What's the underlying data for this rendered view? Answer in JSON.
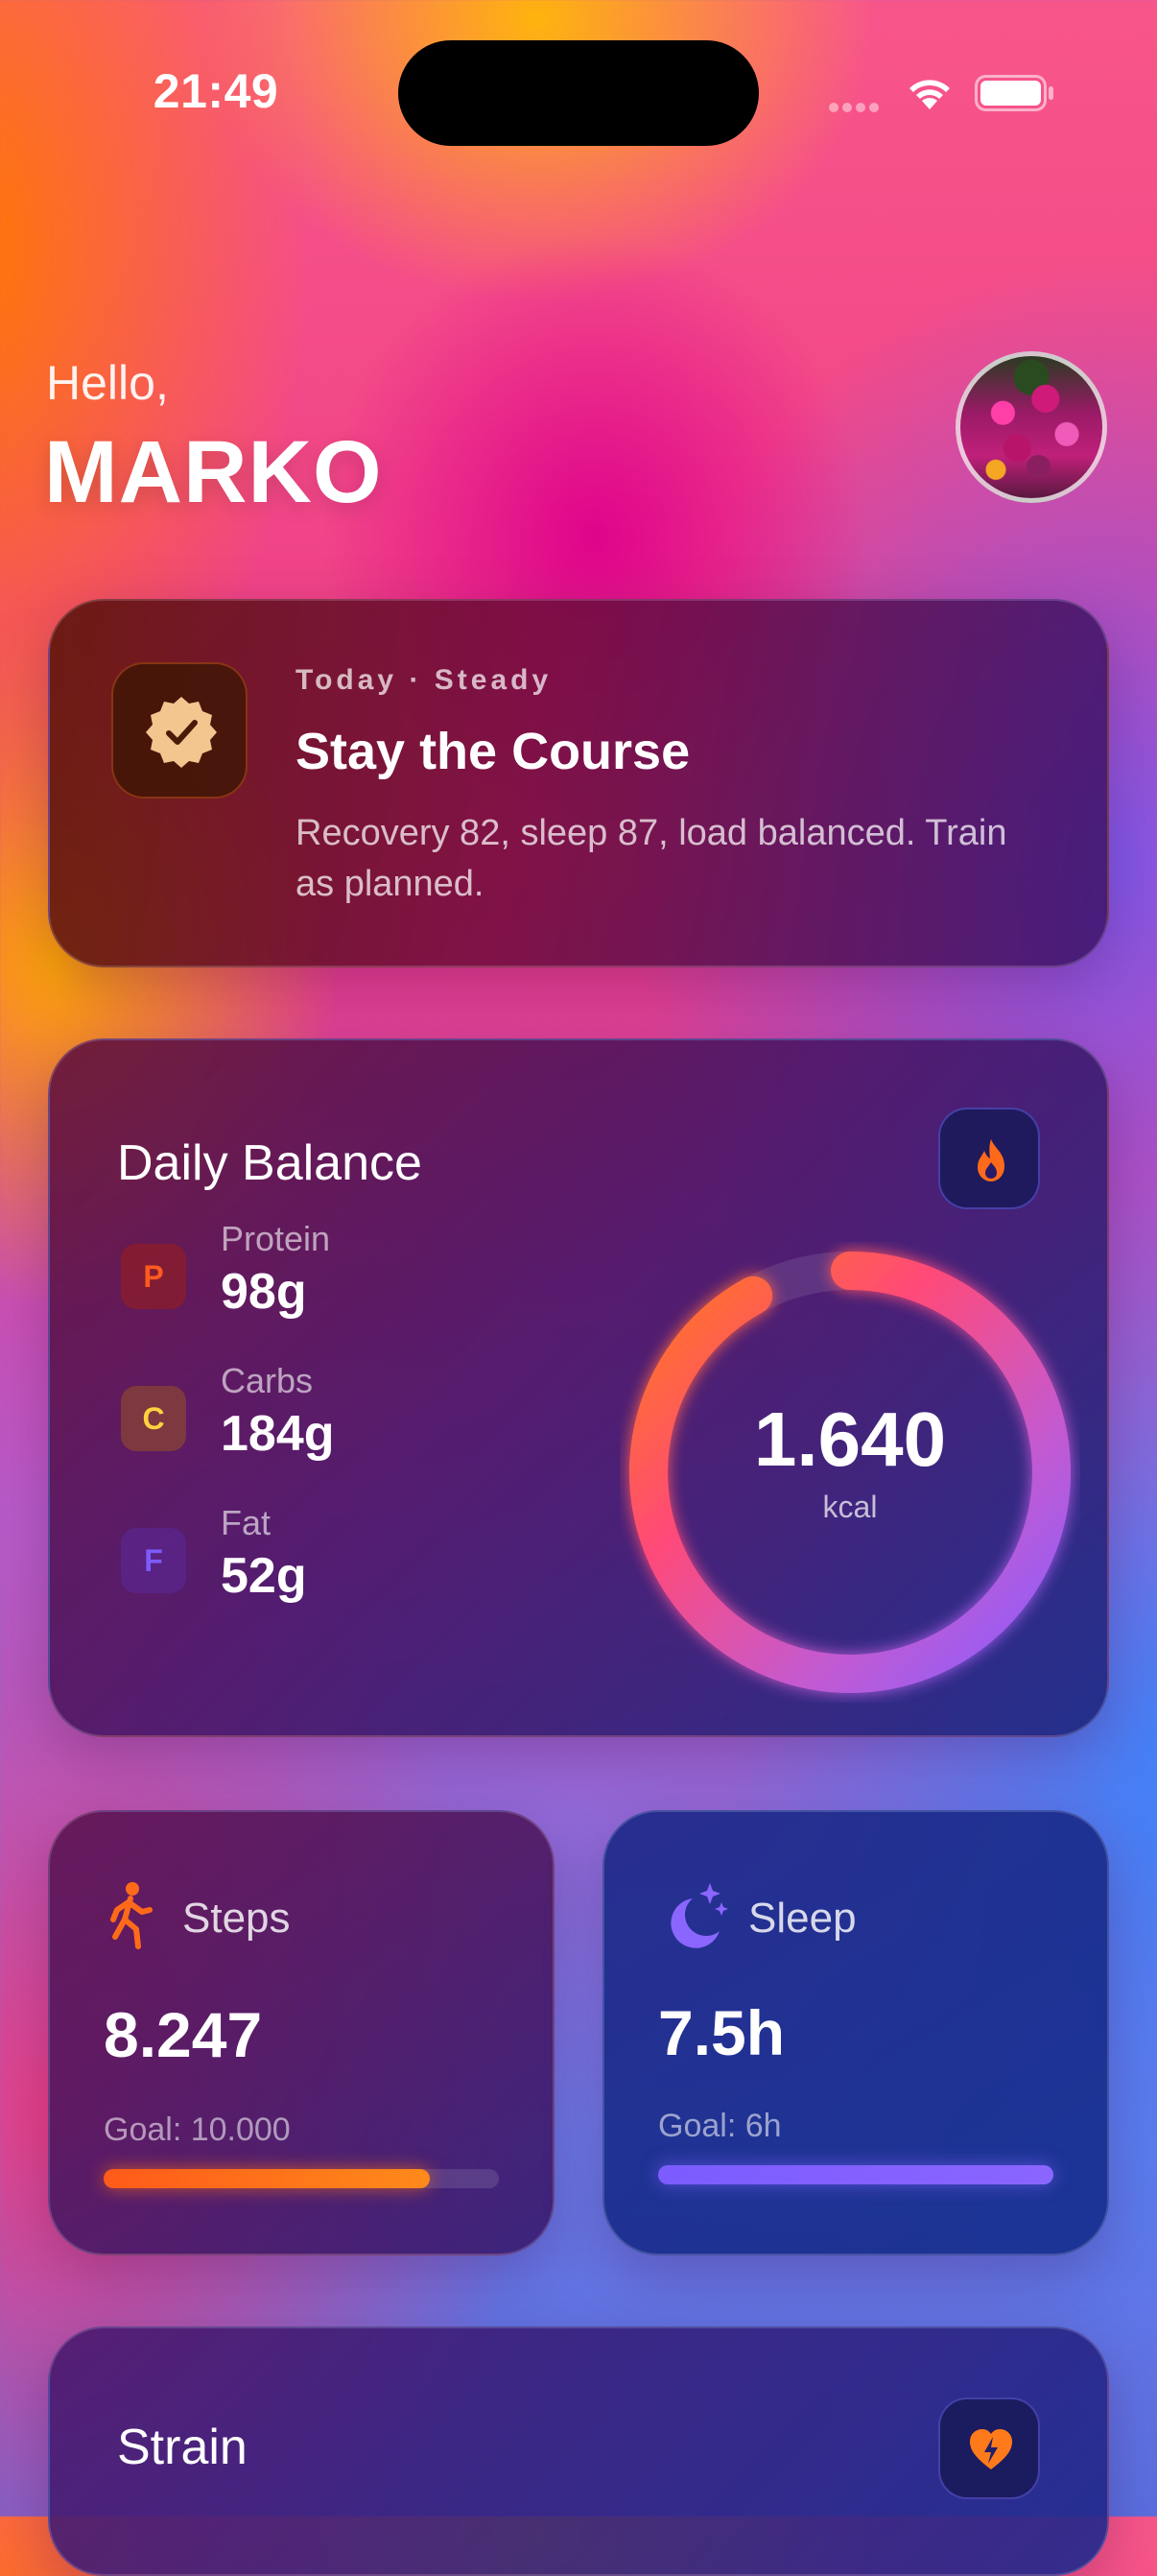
{
  "status_bar": {
    "time": "21:49"
  },
  "header": {
    "greeting": "Hello,",
    "name": "MARKO"
  },
  "insight": {
    "eyebrow": "Today · Steady",
    "title": "Stay the Course",
    "body": "Recovery 82, sleep 87, load balanced. Train as planned."
  },
  "daily_balance": {
    "title": "Daily Balance",
    "macros": [
      {
        "badge": "P",
        "label": "Protein",
        "value": "98g",
        "color": "#ff5a1f"
      },
      {
        "badge": "C",
        "label": "Carbs",
        "value": "184g",
        "color": "#ffd23f"
      },
      {
        "badge": "F",
        "label": "Fat",
        "value": "52g",
        "color": "#7c5cff"
      }
    ],
    "calories": "1.640",
    "calories_unit": "kcal",
    "ring_progress": 0.92
  },
  "steps": {
    "label": "Steps",
    "value": "8.247",
    "goal": "Goal: 10.000",
    "progress": 0.8247
  },
  "sleep": {
    "label": "Sleep",
    "value": "7.5h",
    "goal": "Goal: 6h",
    "progress": 1.0
  },
  "strain": {
    "title": "Strain"
  },
  "colors": {
    "accent_orange": "#ff6a1a",
    "accent_purple": "#7c5cff",
    "accent_pink": "#ff4a78"
  },
  "icons": {
    "insight": "verified-badge-icon",
    "balance": "flame-icon",
    "steps": "walking-figure-icon",
    "sleep": "moon-stars-icon",
    "strain": "heart-bolt-icon"
  }
}
